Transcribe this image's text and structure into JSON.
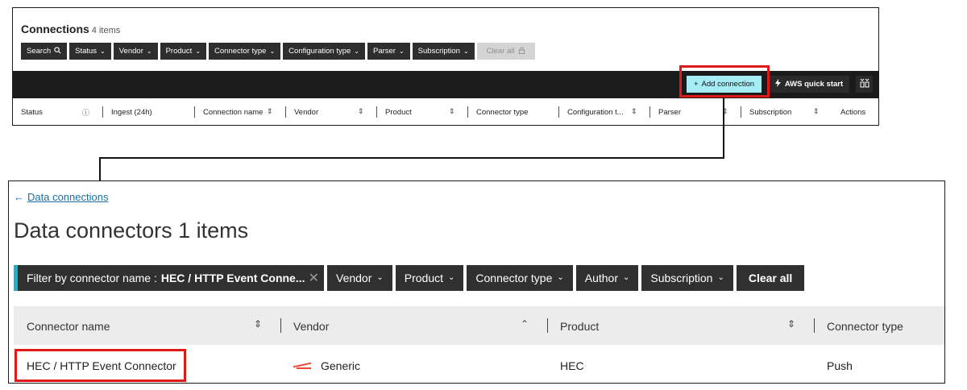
{
  "panel1": {
    "title": "Connections",
    "count": "4 items",
    "filters": [
      {
        "label": "Search",
        "icon": "search-icon"
      },
      {
        "label": "Status"
      },
      {
        "label": "Vendor"
      },
      {
        "label": "Product"
      },
      {
        "label": "Connector type"
      },
      {
        "label": "Configuration type"
      },
      {
        "label": "Parser"
      },
      {
        "label": "Subscription"
      }
    ],
    "clear_all": "Clear all",
    "add_connection": "Add connection",
    "aws_quick_start": "AWS quick start",
    "columns": [
      "Status",
      "Ingest (24h)",
      "Connection name",
      "Vendor",
      "Product",
      "Connector type",
      "Configuration t...",
      "Parser",
      "Subscription",
      "Actions"
    ]
  },
  "panel2": {
    "back_link": "Data connections",
    "title": "Data connectors 1 items",
    "active_filter": {
      "label": "Filter by connector name :",
      "value": "HEC / HTTP Event Conne..."
    },
    "filters": [
      "Vendor",
      "Product",
      "Connector type",
      "Author",
      "Subscription"
    ],
    "clear_all": "Clear all",
    "columns": [
      "Connector name",
      "Vendor",
      "Product",
      "Connector type"
    ],
    "rows": [
      {
        "connector_name": "HEC / HTTP Event Connector",
        "vendor": "Generic",
        "product": "HEC",
        "connector_type": "Push"
      }
    ]
  },
  "colors": {
    "highlight": "#e01818",
    "add_button": "#a6ecf5",
    "filter_accent": "#18b4c9",
    "dark_button": "#2e2e2e"
  }
}
